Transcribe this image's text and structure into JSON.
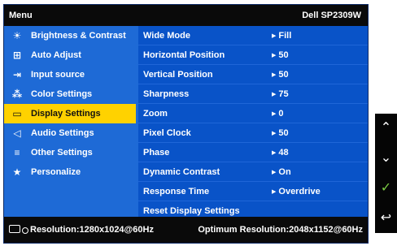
{
  "header": {
    "title": "Menu",
    "model": "Dell SP2309W"
  },
  "nav": [
    {
      "label": "Brightness & Contrast",
      "icon": "brightness-icon",
      "glyph": "☀"
    },
    {
      "label": "Auto Adjust",
      "icon": "auto-adjust-icon",
      "glyph": "⊞"
    },
    {
      "label": "Input source",
      "icon": "input-source-icon",
      "glyph": "⇥"
    },
    {
      "label": "Color Settings",
      "icon": "color-settings-icon",
      "glyph": "⁂"
    },
    {
      "label": "Display Settings",
      "icon": "display-settings-icon",
      "glyph": "▭"
    },
    {
      "label": "Audio Settings",
      "icon": "speaker-icon",
      "glyph": "◁"
    },
    {
      "label": "Other Settings",
      "icon": "other-settings-icon",
      "glyph": "≡"
    },
    {
      "label": "Personalize",
      "icon": "star-icon",
      "glyph": "★"
    }
  ],
  "selected_nav": "Display Settings",
  "settings": [
    {
      "label": "Wide Mode",
      "value": "Fill"
    },
    {
      "label": "Horizontal Position",
      "value": "50"
    },
    {
      "label": "Vertical Position",
      "value": "50"
    },
    {
      "label": "Sharpness",
      "value": "75"
    },
    {
      "label": "Zoom",
      "value": "0"
    },
    {
      "label": "Pixel Clock",
      "value": "50"
    },
    {
      "label": "Phase",
      "value": "48"
    },
    {
      "label": "Dynamic Contrast",
      "value": "On"
    },
    {
      "label": "Response Time",
      "value": "Overdrive"
    },
    {
      "label": "Reset Display Settings",
      "value": ""
    }
  ],
  "status": {
    "resolution": "Resolution:1280x1024@60Hz",
    "optimum": "Optimum Resolution:2048x1152@60Hz"
  },
  "buttons": [
    {
      "name": "up-button",
      "icon": "chevron-up-icon",
      "glyph": "⌃"
    },
    {
      "name": "down-button",
      "icon": "chevron-down-icon",
      "glyph": "⌄"
    },
    {
      "name": "ok-button",
      "icon": "checkmark-icon",
      "glyph": "✓"
    },
    {
      "name": "back-button",
      "icon": "back-arrow-icon",
      "glyph": "↩"
    }
  ],
  "colors": {
    "panel_blue": "#1e6ad6",
    "content_blue": "#0953c8",
    "selected_yellow": "#ffd200",
    "header_black": "#0a0a0a",
    "ok_green": "#7ac943"
  }
}
